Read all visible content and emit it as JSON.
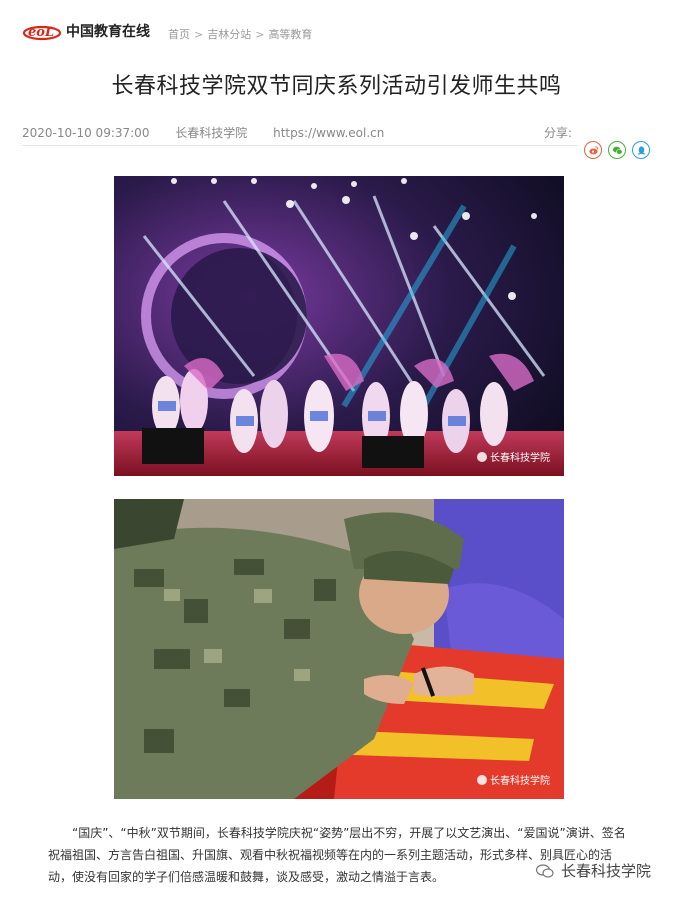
{
  "header": {
    "logo_mark": "eoL",
    "logo_text": "中国教育在线",
    "breadcrumb": [
      "首页",
      "吉林分站",
      "高等教育"
    ],
    "breadcrumb_sep": ">"
  },
  "article": {
    "title": "长春科技学院双节同庆系列活动引发师生共鸣",
    "date": "2020-10-10 09:37:00",
    "source": "长春科技学院",
    "url": "https://www.eol.cn",
    "share_label": "分享:",
    "share_icons": [
      "weibo-icon",
      "wechat-icon",
      "qq-icon"
    ],
    "images": [
      {
        "watermark": "长春科技学院"
      },
      {
        "watermark": "长春科技学院"
      }
    ],
    "paragraph": "“国庆”、“中秋”双节期间，长春科技学院庆祝“姿势”层出不穷，开展了以文艺演出、“爱国说”演讲、签名祝福祖国、方言告白祖国、升国旗、观看中秋祝福视频等在内的一系列主题活动，形式多样、别具匠心的活动，使没有回家的学子们倍感温暖和鼓舞，谈及感受，激动之情溢于言表。",
    "footer_watermark": "长春科技学院"
  },
  "colors": {
    "weibo": "#e6613e",
    "wechat": "#46b035",
    "qq": "#2a9fe3",
    "logo_red": "#d9261c"
  }
}
